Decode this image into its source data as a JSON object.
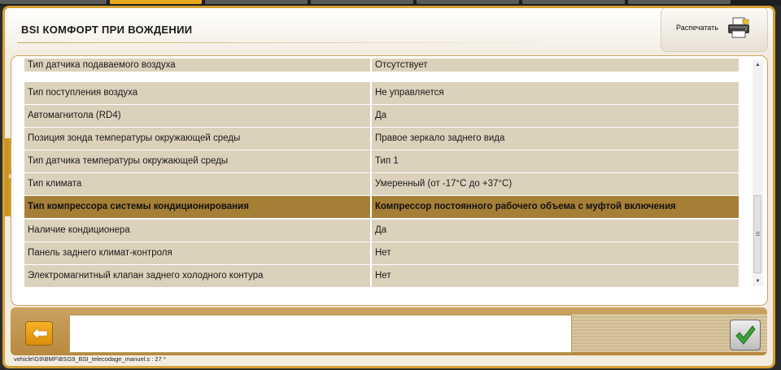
{
  "window": {
    "title": "BSI  КОМФОРТ ПРИ ВОЖДЕНИИ"
  },
  "toolbar": {
    "print_label": "Распечатать",
    "print_icon": "printer-icon"
  },
  "table": {
    "rows": [
      {
        "name": "Тип датчика подаваемого воздуха",
        "value": "Отсутствует"
      },
      {
        "name": "Тип поступления воздуха",
        "value": "Не управляется"
      },
      {
        "name": "Автомагнитола (RD4)",
        "value": "Да"
      },
      {
        "name": "Позиция зонда температуры окружающей среды",
        "value": "Правое зеркало заднего вида"
      },
      {
        "name": "Тип датчика температуры окружающей среды",
        "value": "Тип 1"
      },
      {
        "name": "Тип климата",
        "value": "Умеренный (от -17°С до +37°С)"
      },
      {
        "name": "Тип компрессора системы кондиционирования",
        "value": "Компрессор постоянного рабочего объема с муфтой включения",
        "selected": true
      },
      {
        "name": "Наличие кондиционера",
        "value": "Да"
      },
      {
        "name": "Панель заднего климат-контроля",
        "value": "Нет"
      },
      {
        "name": "Электромагнитный клапан заднего холодного контура",
        "value": "Нет"
      }
    ]
  },
  "footer": {
    "back_icon": "arrow-left-icon",
    "confirm_icon": "checkmark-icon",
    "message": "",
    "status_path": "vehicle\\G9\\BMF\\BSG9_BSI_telecodage_manuel.s : 27 *"
  },
  "colors": {
    "accent": "#e8a61c",
    "row_bg": "#dcd1bb",
    "row_selected": "#a67f37",
    "frame_border": "#d4a033"
  }
}
